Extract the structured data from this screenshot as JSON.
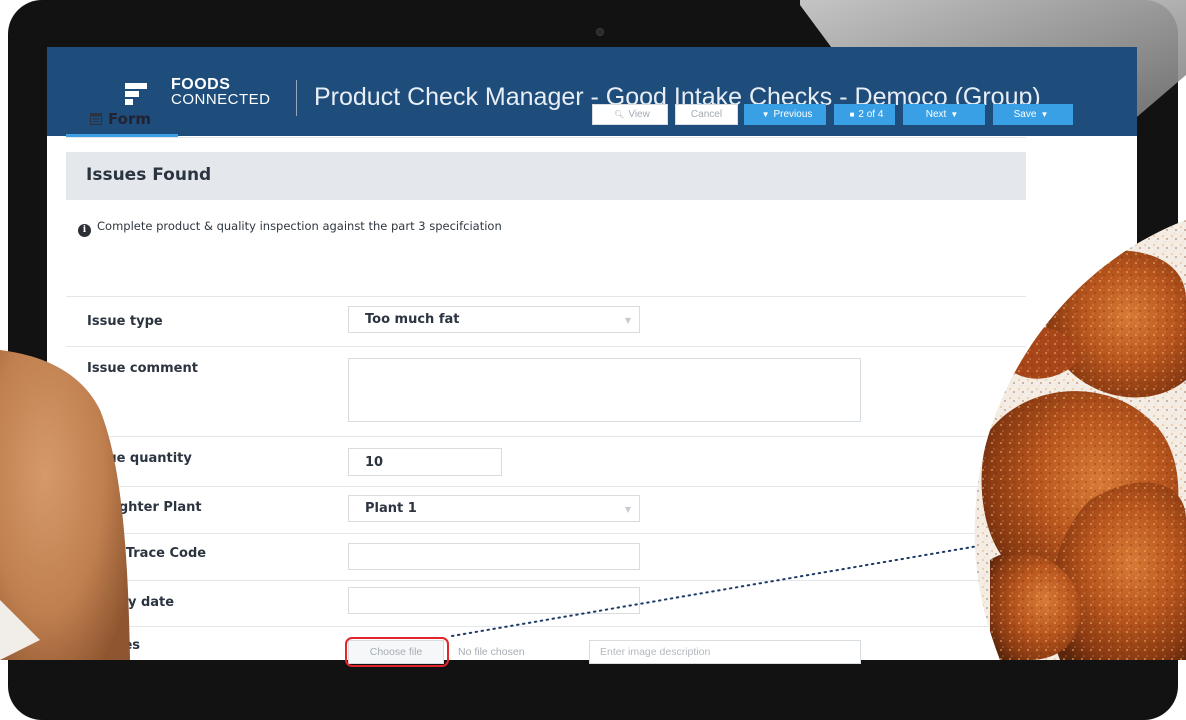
{
  "brand": {
    "line1": "FOODS",
    "line2": "CONNECTED"
  },
  "app_title": "Product Check Manager - Good Intake Checks - Democo (Group)",
  "tab": {
    "label": "Form",
    "icon": "form-icon"
  },
  "toolbar": {
    "view": "View",
    "cancel": "Cancel",
    "previous": "Previous",
    "page": "2 of 4",
    "next": "Next",
    "save": "Save"
  },
  "section": {
    "title": "Issues Found",
    "info": "Complete product & quality inspection against the part 3 specifciation"
  },
  "fields": {
    "issue_type": {
      "label": "Issue type",
      "value": "Too much fat"
    },
    "issue_comment": {
      "label": "Issue comment",
      "value": ""
    },
    "issue_quantity": {
      "label": "Issue quantity",
      "value": "10"
    },
    "slaughter_plant": {
      "label": "Slaughter Plant",
      "value": "Plant 1"
    },
    "pack_trace_code": {
      "label": "Pack Trace Code",
      "value": ""
    },
    "use_by_date": {
      "label": "Use by date",
      "value": ""
    },
    "images": {
      "label": "Images",
      "choose_file": "Choose file",
      "no_file": "No file chosen",
      "description_placeholder": "Enter image description"
    }
  },
  "colors": {
    "header": "#1e4d7b",
    "accent": "#3aa0e6",
    "highlight": "#e2262b"
  }
}
